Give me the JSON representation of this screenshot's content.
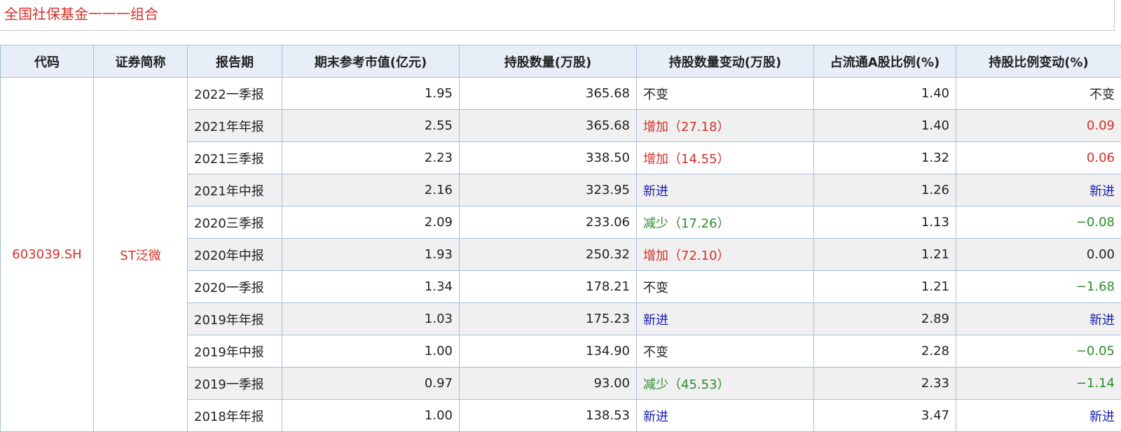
{
  "title": "全国社保基金一一一组合",
  "colors": {
    "accent_red": "#d3302a",
    "decrease_green": "#2e8b2e",
    "new_blue": "#1a1aa8",
    "header_bg": "#e7eef7",
    "border": "#a7bfdc"
  },
  "columns": [
    "代码",
    "证券简称",
    "报告期",
    "期末参考市值(亿元)",
    "持股数量(万股)",
    "持股数量变动(万股)",
    "占流通A股比例(%)",
    "持股比例变动(%)"
  ],
  "security": {
    "code": "603039.SH",
    "name": "ST泛微"
  },
  "rows": [
    {
      "period": "2022一季报",
      "market_value": "1.95",
      "shares": "365.68",
      "share_change": "不变",
      "share_change_kind": "same",
      "float_ratio": "1.40",
      "ratio_change": "不变",
      "ratio_change_kind": "same"
    },
    {
      "period": "2021年年报",
      "market_value": "2.55",
      "shares": "365.68",
      "share_change": "增加（27.18）",
      "share_change_kind": "up",
      "float_ratio": "1.40",
      "ratio_change": "0.09",
      "ratio_change_kind": "up"
    },
    {
      "period": "2021三季报",
      "market_value": "2.23",
      "shares": "338.50",
      "share_change": "增加（14.55）",
      "share_change_kind": "up",
      "float_ratio": "1.32",
      "ratio_change": "0.06",
      "ratio_change_kind": "up"
    },
    {
      "period": "2021年中报",
      "market_value": "2.16",
      "shares": "323.95",
      "share_change": "新进",
      "share_change_kind": "new",
      "float_ratio": "1.26",
      "ratio_change": "新进",
      "ratio_change_kind": "new"
    },
    {
      "period": "2020三季报",
      "market_value": "2.09",
      "shares": "233.06",
      "share_change": "减少（17.26）",
      "share_change_kind": "down",
      "float_ratio": "1.13",
      "ratio_change": "−0.08",
      "ratio_change_kind": "down"
    },
    {
      "period": "2020年中报",
      "market_value": "1.93",
      "shares": "250.32",
      "share_change": "增加（72.10）",
      "share_change_kind": "up",
      "float_ratio": "1.21",
      "ratio_change": "0.00",
      "ratio_change_kind": "same"
    },
    {
      "period": "2020一季报",
      "market_value": "1.34",
      "shares": "178.21",
      "share_change": "不变",
      "share_change_kind": "same",
      "float_ratio": "1.21",
      "ratio_change": "−1.68",
      "ratio_change_kind": "down"
    },
    {
      "period": "2019年年报",
      "market_value": "1.03",
      "shares": "175.23",
      "share_change": "新进",
      "share_change_kind": "new",
      "float_ratio": "2.89",
      "ratio_change": "新进",
      "ratio_change_kind": "new"
    },
    {
      "period": "2019年中报",
      "market_value": "1.00",
      "shares": "134.90",
      "share_change": "不变",
      "share_change_kind": "same",
      "float_ratio": "2.28",
      "ratio_change": "−0.05",
      "ratio_change_kind": "down"
    },
    {
      "period": "2019一季报",
      "market_value": "0.97",
      "shares": "93.00",
      "share_change": "减少（45.53）",
      "share_change_kind": "down",
      "float_ratio": "2.33",
      "ratio_change": "−1.14",
      "ratio_change_kind": "down"
    },
    {
      "period": "2018年年报",
      "market_value": "1.00",
      "shares": "138.53",
      "share_change": "新进",
      "share_change_kind": "new",
      "float_ratio": "3.47",
      "ratio_change": "新进",
      "ratio_change_kind": "new"
    }
  ]
}
